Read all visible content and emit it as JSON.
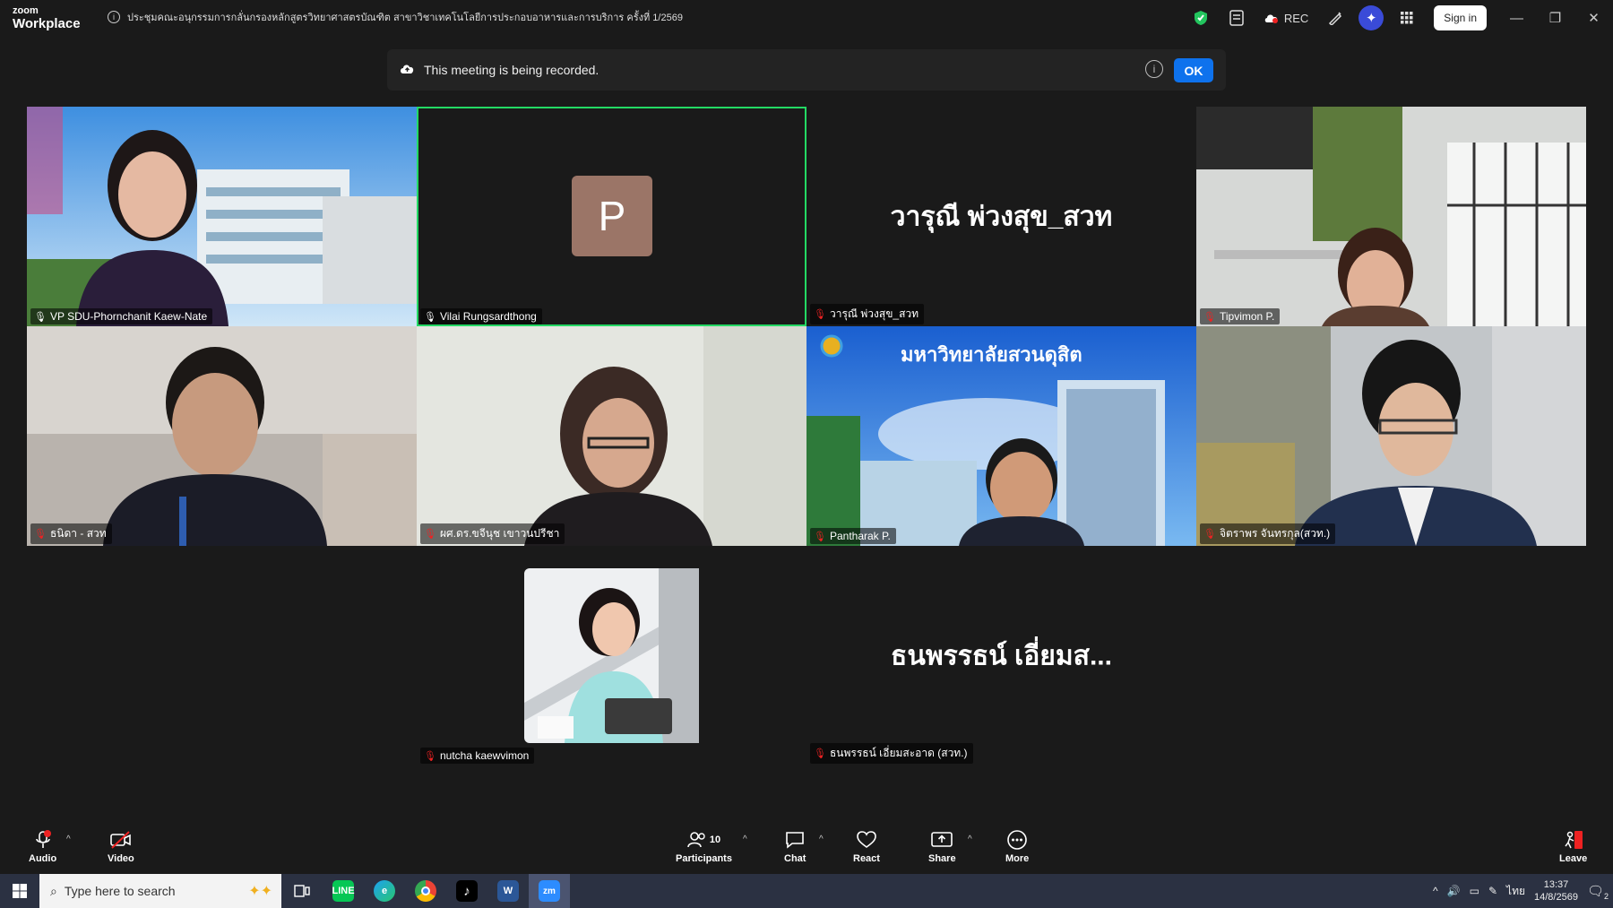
{
  "app": {
    "logo_line1": "zoom",
    "logo_line2": "Workplace",
    "meeting_title": "ประชุมคณะอนุกรรมการกลั่นกรองหลักสูตรวิทยาศาสตรบัณฑิต สาขาวิชาเทคโนโลยีการประกอบอาหารและการบริการ ครั้งที่ 1/2569"
  },
  "titlebar": {
    "rec_label": "REC",
    "signin_label": "Sign in",
    "icons": [
      "shield-check-icon",
      "notes-icon",
      "cloud-rec-icon",
      "whiteboard-icon",
      "ai-companion-icon",
      "apps-grid-icon"
    ]
  },
  "banner": {
    "text": "This meeting is being recorded.",
    "ok_label": "OK"
  },
  "participants": [
    {
      "name": "VP SDU-Phornchanit Kaew-Nate",
      "mic": "on"
    },
    {
      "name": "Vilai Rungsardthong",
      "mic": "on",
      "avatar_letter": "P",
      "active_speaker": true
    },
    {
      "name": "วารุณี พ่วงสุข_สวท",
      "mic": "muted",
      "big_name": "วารุณี พ่วงสุข_สวท"
    },
    {
      "name": "Tipvimon P.",
      "mic": "muted"
    },
    {
      "name": "ธนิดา - สวท",
      "mic": "muted"
    },
    {
      "name": "ผศ.ดร.ขจีนุช เขาวนปรีชา",
      "mic": "muted"
    },
    {
      "name": "Pantharak P.",
      "mic": "muted",
      "background_text": "มหาวิทยาลัยสวนดุสิต"
    },
    {
      "name": "จิตราพร จันทรกุล(สวท.)",
      "mic": "muted"
    },
    {
      "name": "nutcha kaewvimon",
      "mic": "muted"
    },
    {
      "name": "ธนพรรธน์ เอี่ยมสะอาด (สวท.)",
      "mic": "muted",
      "big_name": "ธนพรรธน์ เอี่ยมส..."
    }
  ],
  "toolbar": {
    "audio_label": "Audio",
    "video_label": "Video",
    "participants_label": "Participants",
    "participants_count": "10",
    "chat_label": "Chat",
    "react_label": "React",
    "share_label": "Share",
    "more_label": "More",
    "leave_label": "Leave"
  },
  "taskbar": {
    "search_placeholder": "Type here to search",
    "apps": [
      "task-view-icon",
      "line-app-icon",
      "edge-icon",
      "chrome-icon",
      "tiktok-icon",
      "word-icon",
      "zoom-app-icon"
    ],
    "lang": "ไทย",
    "time": "13:37",
    "date": "14/8/2569",
    "notification_count": "2"
  },
  "colors": {
    "active_speaker": "#23d964",
    "ok_button": "#0e72ed",
    "muted_mic": "#e22222",
    "avatar_bg": "#9b7567"
  }
}
